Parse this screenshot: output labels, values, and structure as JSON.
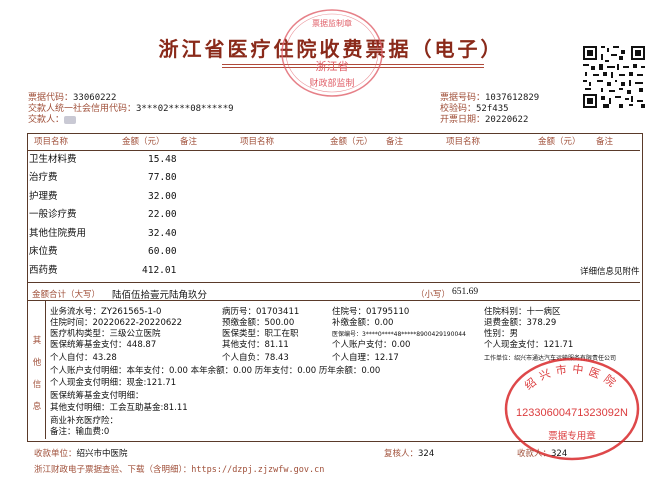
{
  "title": "浙江省医疗住院收费票据（电子）",
  "header_left": {
    "code_label": "票据代码：",
    "code_value": "33060222",
    "credit_label": "交款人统一社会信用代码：",
    "credit_value": "3***02****08*****9",
    "payer_label": "交款人："
  },
  "header_right": {
    "number_label": "票据号码：",
    "number_value": "1037612829",
    "check_label": "校验码：",
    "check_value": "52f435",
    "date_label": "开票日期：",
    "date_value": "20220622"
  },
  "columns": {
    "item": "项目名称",
    "amount": "金额（元）",
    "note": "备注"
  },
  "items": [
    {
      "name": "卫生材料费",
      "amount": "15.48"
    },
    {
      "name": "治疗费",
      "amount": "77.80"
    },
    {
      "name": "护理费",
      "amount": "32.00"
    },
    {
      "name": "一般诊疗费",
      "amount": "22.00"
    },
    {
      "name": "其他住院费用",
      "amount": "32.40"
    },
    {
      "name": "床位费",
      "amount": "60.00"
    },
    {
      "name": "西药费",
      "amount": "412.01"
    }
  ],
  "detail_note": "详细信息见附件",
  "total": {
    "label_caps": "金额合计（大写）",
    "caps_value": "陆佰伍拾壹元陆角玖分",
    "label_small": "（小写）",
    "small_value": "651.69"
  },
  "other_info_label": "其他信息",
  "info": {
    "serial": "业务流水号：ZY261565-1-0",
    "case_no": "病历号：01703411",
    "inpatient_no": "住院号：01795110",
    "ward": "住院科别：十一病区",
    "dates": "住院时间：20220622-20220622",
    "prepaid": "预缴金额：500.00",
    "supplement": "补缴金额：0.00",
    "refund": "退费金额：378.29",
    "org_type": "医疗机构类型：三级公立医院",
    "insurance_type": "医保类型：职工在职",
    "insurance_no": "医保编号：3****0****48*****8900429190044",
    "gender": "性别：男",
    "fund_paid": "医保统筹基金支付：448.87",
    "other_paid": "其他支付：81.11",
    "personal_account": "个人账户支付：0.00",
    "cash_paid": "个人现金支付：121.71",
    "self_pay": "个人自付：43.28",
    "personal_burden": "个人自负：78.43",
    "self_care": "个人自理：12.17",
    "employer": "工作单位：绍兴市通达汽车运输服务有限责任公司",
    "account_detail": "个人账户支付明细：本年支付：0.00 本年余额：0.00 历年支付：0.00 历年余额：0.00",
    "cash_detail": "个人现金支付明细：现金:121.71",
    "fund_detail": "医保统筹基金支付明细：",
    "other_detail": "其他支付明细：工会互助基金:81.11",
    "commercial": "商业补充医疗险：",
    "remark": "备注：输血费:0"
  },
  "footer": {
    "collector_label": "收款单位：",
    "collector_value": "绍兴市中医院",
    "reviewer_label": "复核人：",
    "reviewer_value": "324",
    "cashier_label": "收款人：",
    "cashier_value": "324",
    "query": "浙江财政电子票据查验、下载（含明细）：https://dzpj.zjzwfw.gov.cn"
  },
  "seals": {
    "finance_seal": [
      "浙江省",
      "财政部监制",
      "票据监制章"
    ],
    "hospital_seal": {
      "name": "绍兴市中医院",
      "number": "12330600471323092N",
      "purpose": "票据专用章"
    }
  },
  "colors": {
    "seal_red": "#d8282a",
    "label_brown": "#a0503a",
    "title_red": "#8a2a1a"
  }
}
